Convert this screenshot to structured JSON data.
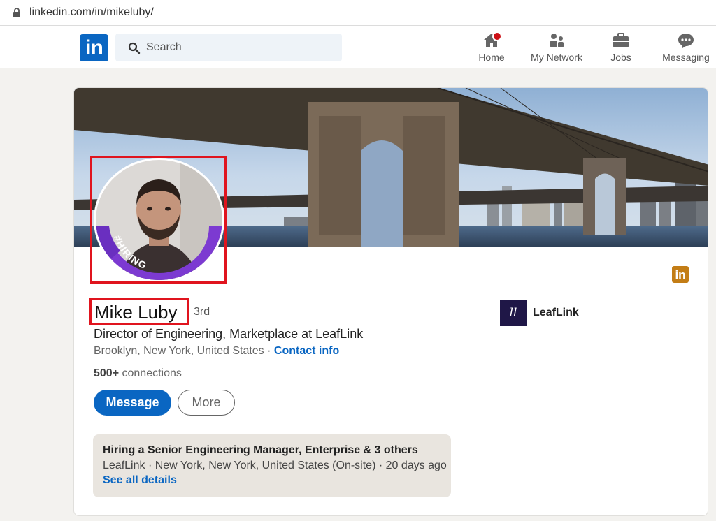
{
  "browser": {
    "url": "linkedin.com/in/mikeluby/"
  },
  "nav": {
    "logo": "in",
    "search_placeholder": "Search",
    "items": [
      {
        "label": "Home"
      },
      {
        "label": "My Network"
      },
      {
        "label": "Jobs"
      },
      {
        "label": "Messaging"
      }
    ]
  },
  "profile": {
    "avatar_badge": "#HIRING",
    "name": "Mike Luby",
    "degree": "3rd",
    "headline": "Director of Engineering, Marketplace at LeafLink",
    "location": "Brooklyn, New York, United States",
    "separator": " · ",
    "contact_info": "Contact info",
    "connections_count": "500+",
    "connections_label": " connections",
    "message_button": "Message",
    "more_button": "More",
    "mini_logo": "in",
    "company": {
      "logo_text": "ll",
      "name": "LeafLink"
    }
  },
  "hiring": {
    "title": "Hiring a Senior Engineering Manager, Enterprise & 3 others",
    "subtitle": "LeafLink · New York, New York, United States (On-site) · 20 days ago",
    "link": "See all details"
  },
  "colors": {
    "brand": "#0a66c2",
    "highlight_frame": "#e0141e",
    "hiring_ring": "#7c3ad1"
  }
}
